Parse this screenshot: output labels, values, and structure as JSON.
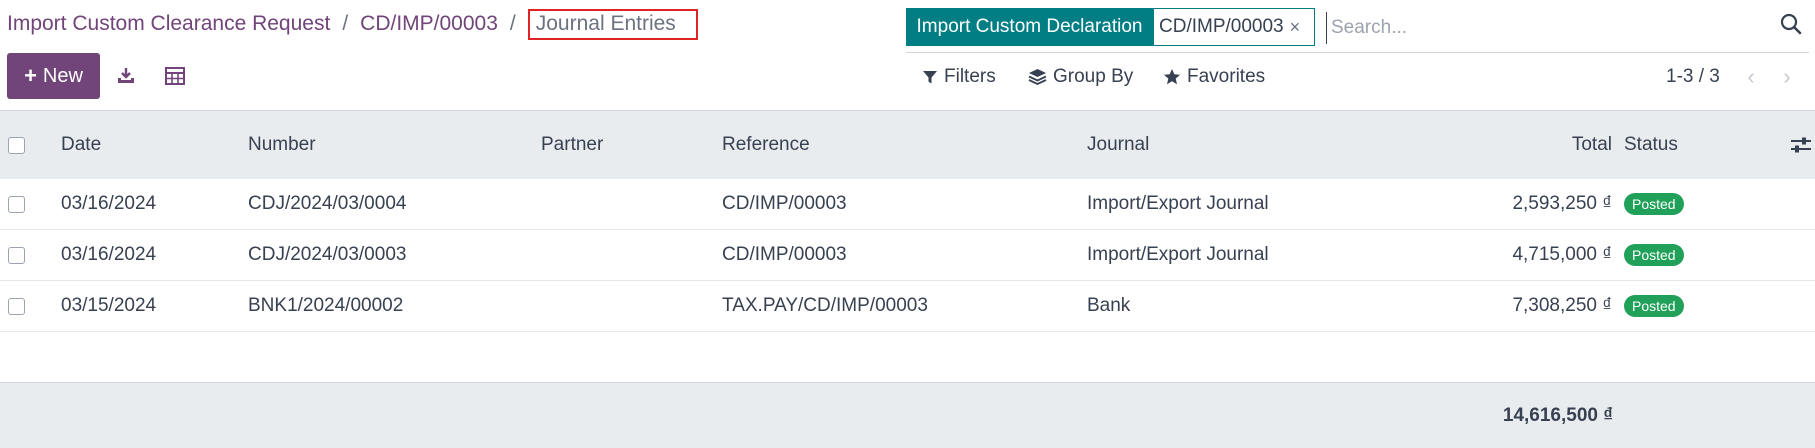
{
  "breadcrumb": {
    "items": [
      "Import Custom Clearance Request",
      "CD/IMP/00003"
    ],
    "separator": "/",
    "current": "Journal Entries"
  },
  "toolbar": {
    "new_label": "New",
    "download_icon": "download-icon",
    "pivot_icon": "table-icon"
  },
  "search": {
    "facet_label": "Import Custom Declaration",
    "facet_value": "CD/IMP/00003",
    "facet_remove": "×",
    "placeholder": "Search..."
  },
  "filters": {
    "filters_label": "Filters",
    "group_by_label": "Group By",
    "favorites_label": "Favorites"
  },
  "pager": {
    "text": "1-3 / 3"
  },
  "table": {
    "columns": [
      "Date",
      "Number",
      "Partner",
      "Reference",
      "Journal",
      "Total",
      "Status"
    ],
    "rows": [
      {
        "date": "03/16/2024",
        "number": "CDJ/2024/03/0004",
        "partner": "",
        "reference": "CD/IMP/00003",
        "journal": "Import/Export Journal",
        "total": "2,593,250 ₫",
        "status": "Posted"
      },
      {
        "date": "03/16/2024",
        "number": "CDJ/2024/03/0003",
        "partner": "",
        "reference": "CD/IMP/00003",
        "journal": "Import/Export Journal",
        "total": "4,715,000 ₫",
        "status": "Posted"
      },
      {
        "date": "03/15/2024",
        "number": "BNK1/2024/00002",
        "partner": "",
        "reference": "TAX.PAY/CD/IMP/00003",
        "journal": "Bank",
        "total": "7,308,250 ₫",
        "status": "Posted"
      }
    ],
    "sum_total": "14,616,500 ₫"
  },
  "colors": {
    "brand": "#71447a",
    "facet": "#017e84",
    "posted_badge": "#21a05a",
    "highlight_box": "#e02424"
  }
}
